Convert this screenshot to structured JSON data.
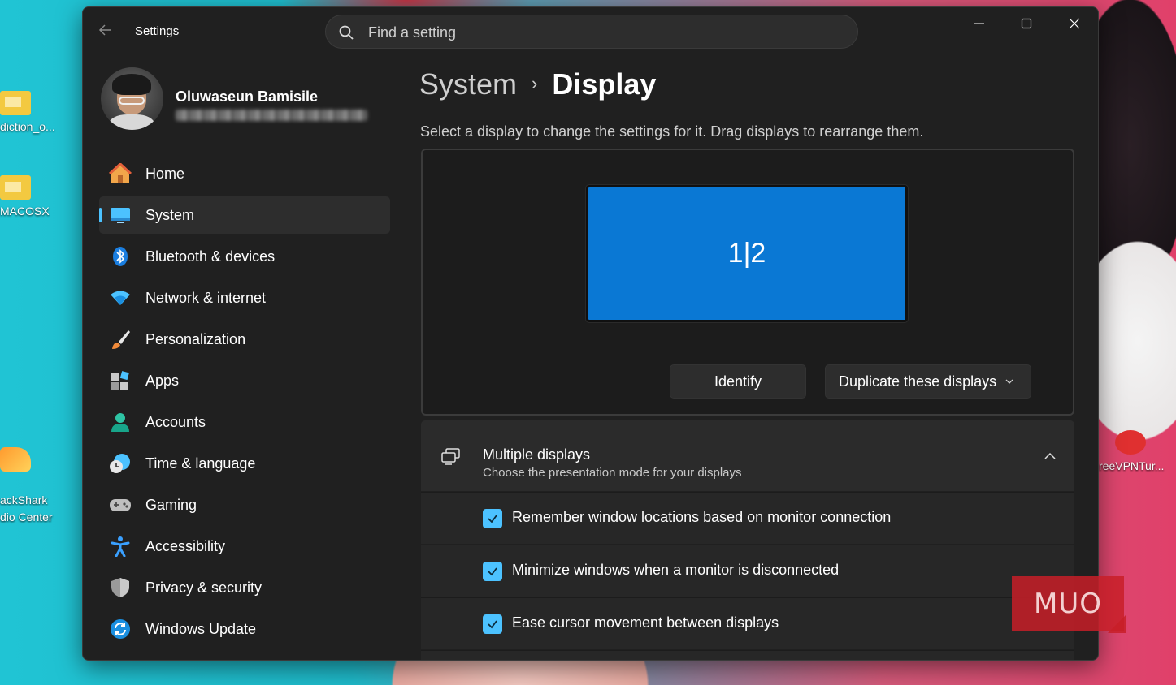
{
  "desktop": {
    "icons": [
      {
        "label": "diction_o...",
        "kind": "folder"
      },
      {
        "label": "MACOSX",
        "kind": "folder"
      },
      {
        "label": "ackShark\ndio Center",
        "kind": "app"
      },
      {
        "label": "reeVPNTur...",
        "kind": "app"
      }
    ]
  },
  "window": {
    "title": "Settings",
    "search": {
      "placeholder": "Find a setting"
    },
    "controls": {
      "minimize": "minimize-icon",
      "maximize": "maximize-icon",
      "close": "close-icon"
    }
  },
  "profile": {
    "name": "Oluwaseun Bamisile"
  },
  "nav": {
    "items": [
      {
        "label": "Home",
        "icon": "home-icon"
      },
      {
        "label": "System",
        "icon": "system-icon",
        "selected": true
      },
      {
        "label": "Bluetooth & devices",
        "icon": "bluetooth-icon"
      },
      {
        "label": "Network & internet",
        "icon": "wifi-icon"
      },
      {
        "label": "Personalization",
        "icon": "brush-icon"
      },
      {
        "label": "Apps",
        "icon": "apps-icon"
      },
      {
        "label": "Accounts",
        "icon": "accounts-icon"
      },
      {
        "label": "Time & language",
        "icon": "clock-globe-icon"
      },
      {
        "label": "Gaming",
        "icon": "gamepad-icon"
      },
      {
        "label": "Accessibility",
        "icon": "accessibility-icon"
      },
      {
        "label": "Privacy & security",
        "icon": "shield-icon"
      },
      {
        "label": "Windows Update",
        "icon": "update-icon"
      }
    ]
  },
  "main": {
    "breadcrumb": {
      "parent": "System",
      "separator": "›",
      "current": "Display"
    },
    "subtitle": "Select a display to change the settings for it. Drag displays to rearrange them.",
    "display_panel": {
      "monitor_label": "1|2",
      "identify_label": "Identify",
      "mode_dropdown": {
        "selected": "Duplicate these displays"
      }
    },
    "multiple_displays": {
      "title": "Multiple displays",
      "description": "Choose the presentation mode for your displays",
      "expanded": true,
      "options": [
        {
          "label": "Remember window locations based on monitor connection",
          "checked": true
        },
        {
          "label": "Minimize windows when a monitor is disconnected",
          "checked": true
        },
        {
          "label": "Ease cursor movement between displays",
          "checked": true
        }
      ]
    }
  },
  "watermark": {
    "text": "MUO"
  },
  "colors": {
    "accent": "#4cc2ff",
    "monitor": "#0a78d4",
    "window_bg": "#202020"
  }
}
